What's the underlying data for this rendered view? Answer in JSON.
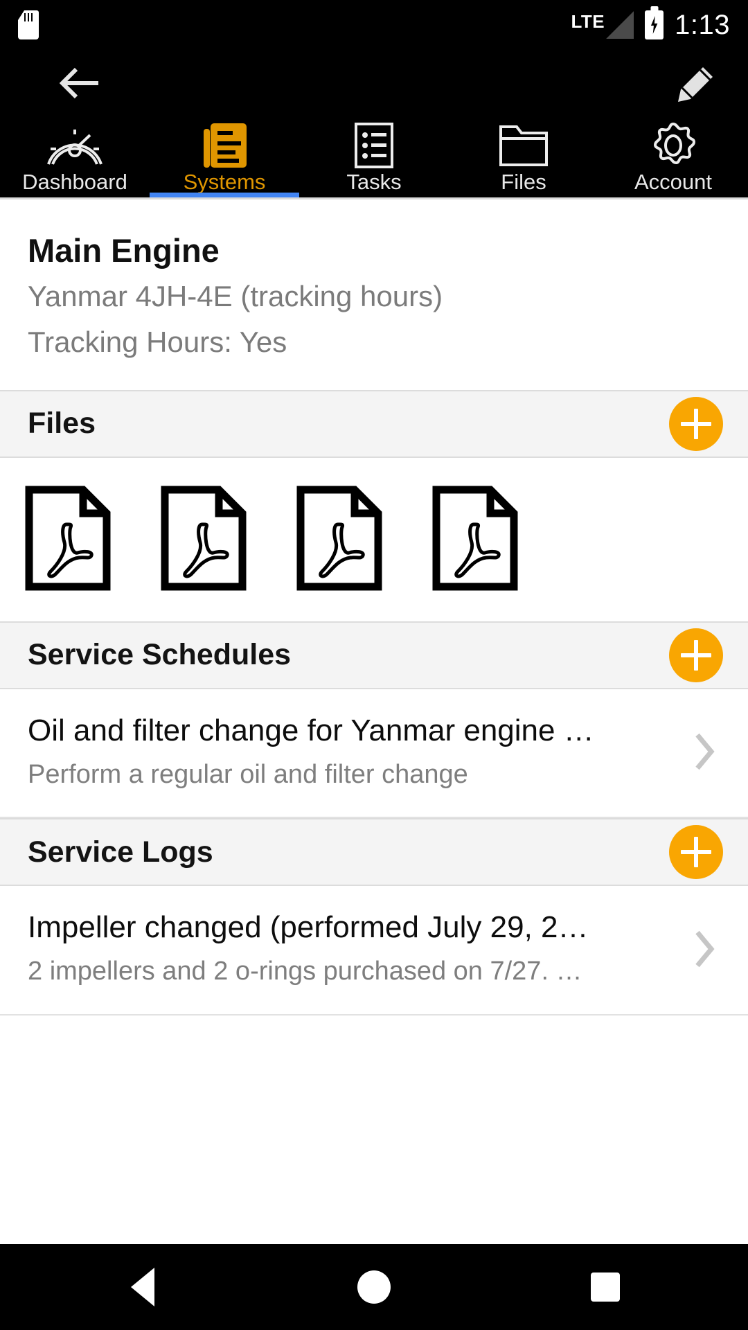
{
  "status_bar": {
    "sd_card_icon": "sd-card-icon",
    "network_label": "LTE",
    "signal_icon": "signal-triangle-icon",
    "battery_icon": "battery-charging-icon",
    "time": "1:13"
  },
  "app_bar": {
    "back_icon": "back-arrow-icon",
    "edit_icon": "pencil-edit-icon"
  },
  "tabs": [
    {
      "label": "Dashboard",
      "icon": "gauge-icon",
      "active": false
    },
    {
      "label": "Systems",
      "icon": "document-list-icon",
      "active": true
    },
    {
      "label": "Tasks",
      "icon": "checklist-icon",
      "active": false
    },
    {
      "label": "Files",
      "icon": "folder-icon",
      "active": false
    },
    {
      "label": "Account",
      "icon": "gear-icon",
      "active": false
    }
  ],
  "detail": {
    "title": "Main Engine",
    "model": "Yanmar 4JH-4E (tracking hours)",
    "tracking": "Tracking Hours: Yes"
  },
  "sections": {
    "files": {
      "title": "Files",
      "add_icon": "plus-icon",
      "items": [
        {
          "icon": "pdf-file-icon"
        },
        {
          "icon": "pdf-file-icon"
        },
        {
          "icon": "pdf-file-icon"
        },
        {
          "icon": "pdf-file-icon"
        }
      ]
    },
    "service_schedules": {
      "title": "Service Schedules",
      "add_icon": "plus-icon",
      "rows": [
        {
          "title": "Oil and filter change for Yanmar engine …",
          "subtitle": "Perform a regular oil and filter change",
          "chevron": "chevron-right-icon"
        }
      ]
    },
    "service_logs": {
      "title": "Service Logs",
      "add_icon": "plus-icon",
      "rows": [
        {
          "title": "Impeller changed (performed July 29, 2…",
          "subtitle": "2 impellers and 2 o-rings purchased on 7/27. …",
          "chevron": "chevron-right-icon"
        }
      ]
    }
  },
  "nav_bar": {
    "back": "nav-back-icon",
    "home": "nav-home-icon",
    "recents": "nav-recents-icon"
  },
  "colors": {
    "accent_orange": "#F9A602",
    "active_tab_text": "#E09600",
    "active_tab_underline": "#4285F4",
    "section_bg": "#F4F4F4",
    "bar_bg": "#000000"
  }
}
